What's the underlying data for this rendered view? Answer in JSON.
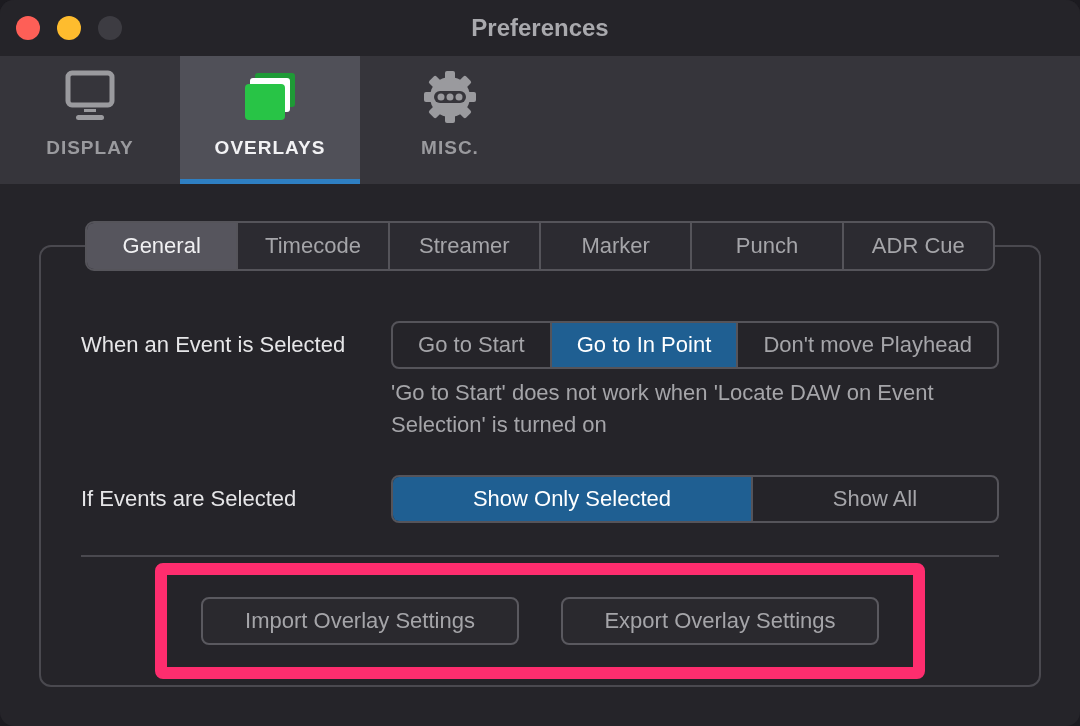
{
  "window": {
    "title": "Preferences",
    "controls": [
      {
        "color": "#fe5f57"
      },
      {
        "color": "#febc2e"
      },
      {
        "color": "#3d3c42"
      }
    ]
  },
  "toolbar": [
    {
      "label": "DISPLAY",
      "kind": "monitor",
      "selected": false
    },
    {
      "label": "OVERLAYS",
      "kind": "layers",
      "selected": true
    },
    {
      "label": "MISC.",
      "kind": "gear",
      "selected": false
    }
  ],
  "tabs": [
    {
      "label": "General",
      "selected": true
    },
    {
      "label": "Timecode",
      "selected": false
    },
    {
      "label": "Streamer",
      "selected": false
    },
    {
      "label": "Marker",
      "selected": false
    },
    {
      "label": "Punch",
      "selected": false
    },
    {
      "label": "ADR Cue",
      "selected": false
    }
  ],
  "settings": [
    {
      "label": "When an Event is Selected",
      "options": [
        {
          "label": "Go to Start",
          "selected": false
        },
        {
          "label": "Go to In Point",
          "selected": true
        },
        {
          "label": "Don't move Playhead",
          "selected": false
        }
      ],
      "note": "'Go to Start' does not work when 'Locate DAW on Event Selection' is turned on"
    },
    {
      "label": "If Events are Selected",
      "options": [
        {
          "label": "Show Only Selected",
          "selected": true
        },
        {
          "label": "Show All",
          "selected": false
        }
      ]
    }
  ],
  "actions": {
    "highlighted": true,
    "buttons": [
      "Import Overlay Settings",
      "Export Overlay Settings"
    ]
  }
}
